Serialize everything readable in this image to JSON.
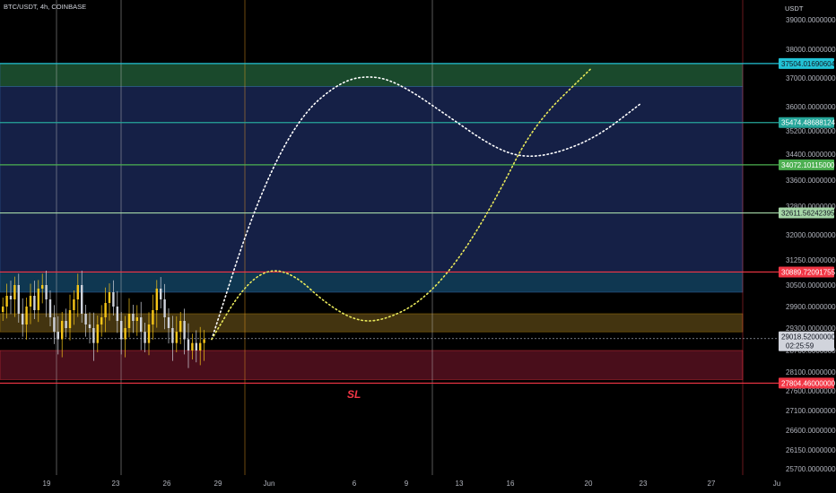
{
  "header": {
    "symbol": "BTC/USDT, 4h, COINBASE"
  },
  "price_axis": {
    "unit": "USDT",
    "ticks": [
      "39000.00000000",
      "38000.00000000",
      "37000.00000000",
      "36000.00000000",
      "35200.00000000",
      "34400.00000000",
      "33600.00000000",
      "32800.00000000",
      "32000.00000000",
      "31250.00000000",
      "30500.00000000",
      "29900.00000000",
      "29300.00000000",
      "28700.00000000",
      "28100.00000000",
      "27600.00000000",
      "27100.00000000",
      "26600.00000000",
      "26150.00000000",
      "25700.00000000"
    ]
  },
  "time_axis": {
    "ticks": [
      "19",
      "23",
      "26",
      "29",
      "Jun",
      "6",
      "9",
      "13",
      "16",
      "20",
      "23",
      "27",
      "Ju"
    ]
  },
  "levels": [
    {
      "price": 37504.01690604,
      "label": "37504.01690604",
      "color": "#22c3d6",
      "text_color": "#131722"
    },
    {
      "price": 35474.48688124,
      "label": "35474.48688124",
      "color": "#26a69a",
      "text_color": "#ffffff"
    },
    {
      "price": 34072.10115,
      "label": "34072.10115000",
      "color": "#4caf50",
      "text_color": "#ffffff"
    },
    {
      "price": 32611.56242395,
      "label": "32611.56242395",
      "color": "#a5d6a7",
      "text_color": "#131722"
    },
    {
      "price": 30889.72091755,
      "label": "30889.72091755",
      "color": "#f23645",
      "text_color": "#ffffff"
    },
    {
      "price": 27804.46,
      "label": "27804.46000000",
      "color": "#f23645",
      "text_color": "#ffffff"
    }
  ],
  "current_price": {
    "label": "29018.52000000",
    "countdown": "02:25:59"
  },
  "annotations": {
    "stop_loss": "SL"
  },
  "colors": {
    "zone_green": "#1b4d2e",
    "zone_blue": "#16224a",
    "zone_teal": "#103a55",
    "zone_orange": "#4a3a12",
    "zone_red": "#4d0f1c",
    "candle_up": "#f5c518",
    "candle_down": "#cfd3dc",
    "path_white": "#ffffff",
    "path_yellow": "#e8e85a"
  },
  "chart_data": {
    "type": "candlestick",
    "title": "BTC/USDT, 4h, COINBASE",
    "ylabel": "USDT",
    "ylim": [
      25500,
      39300
    ],
    "x_ticks": [
      "19",
      "23",
      "26",
      "29",
      "Jun",
      "6",
      "9",
      "13",
      "16",
      "20",
      "23",
      "27",
      "Ju"
    ],
    "horizontal_levels": [
      37504.01690604,
      35474.48688124,
      34072.10115,
      32611.56242395,
      30889.72091755,
      27804.46
    ],
    "last_price": 29018.52,
    "zones": [
      {
        "from": 36700,
        "to": 37504,
        "color": "green"
      },
      {
        "from": 30889,
        "to": 36700,
        "color": "blue"
      },
      {
        "from": 30300,
        "to": 30889,
        "color": "teal"
      },
      {
        "from": 29200,
        "to": 29700,
        "color": "orange"
      },
      {
        "from": 27900,
        "to": 28700,
        "color": "red"
      }
    ],
    "series": [
      {
        "type": "close",
        "values": [
          29900,
          30200,
          30100,
          30500,
          29700,
          29400,
          29900,
          30200,
          29800,
          30400,
          30500,
          30100,
          29600,
          29200,
          29000,
          29500,
          29300,
          29800,
          30100,
          30500,
          29700,
          29400,
          29300,
          28900,
          29400,
          29600,
          30000,
          30300,
          29900,
          29500,
          29000,
          29300,
          29700,
          29500,
          29600,
          29200,
          28900,
          29400,
          29800,
          30400,
          30100,
          29600,
          29300,
          28900,
          29200,
          29500,
          29000,
          28700,
          28900,
          28700,
          28900,
          29000
        ]
      },
      {
        "type": "projection_white",
        "points": [
          [
            0,
            29000
          ],
          [
            0.1,
            32800
          ],
          [
            0.2,
            35600
          ],
          [
            0.3,
            36900
          ],
          [
            0.38,
            37100
          ],
          [
            0.45,
            36700
          ],
          [
            0.55,
            35700
          ],
          [
            0.65,
            34700
          ],
          [
            0.72,
            34300
          ],
          [
            0.8,
            34400
          ],
          [
            0.9,
            35000
          ],
          [
            1,
            36100
          ]
        ]
      },
      {
        "type": "projection_yellow",
        "points": [
          [
            0,
            29000
          ],
          [
            0.08,
            30400
          ],
          [
            0.15,
            31000
          ],
          [
            0.22,
            30800
          ],
          [
            0.3,
            30000
          ],
          [
            0.38,
            29500
          ],
          [
            0.45,
            29500
          ],
          [
            0.55,
            30000
          ],
          [
            0.65,
            31200
          ],
          [
            0.75,
            33000
          ],
          [
            0.85,
            35400
          ],
          [
            1,
            37300
          ]
        ]
      }
    ]
  }
}
